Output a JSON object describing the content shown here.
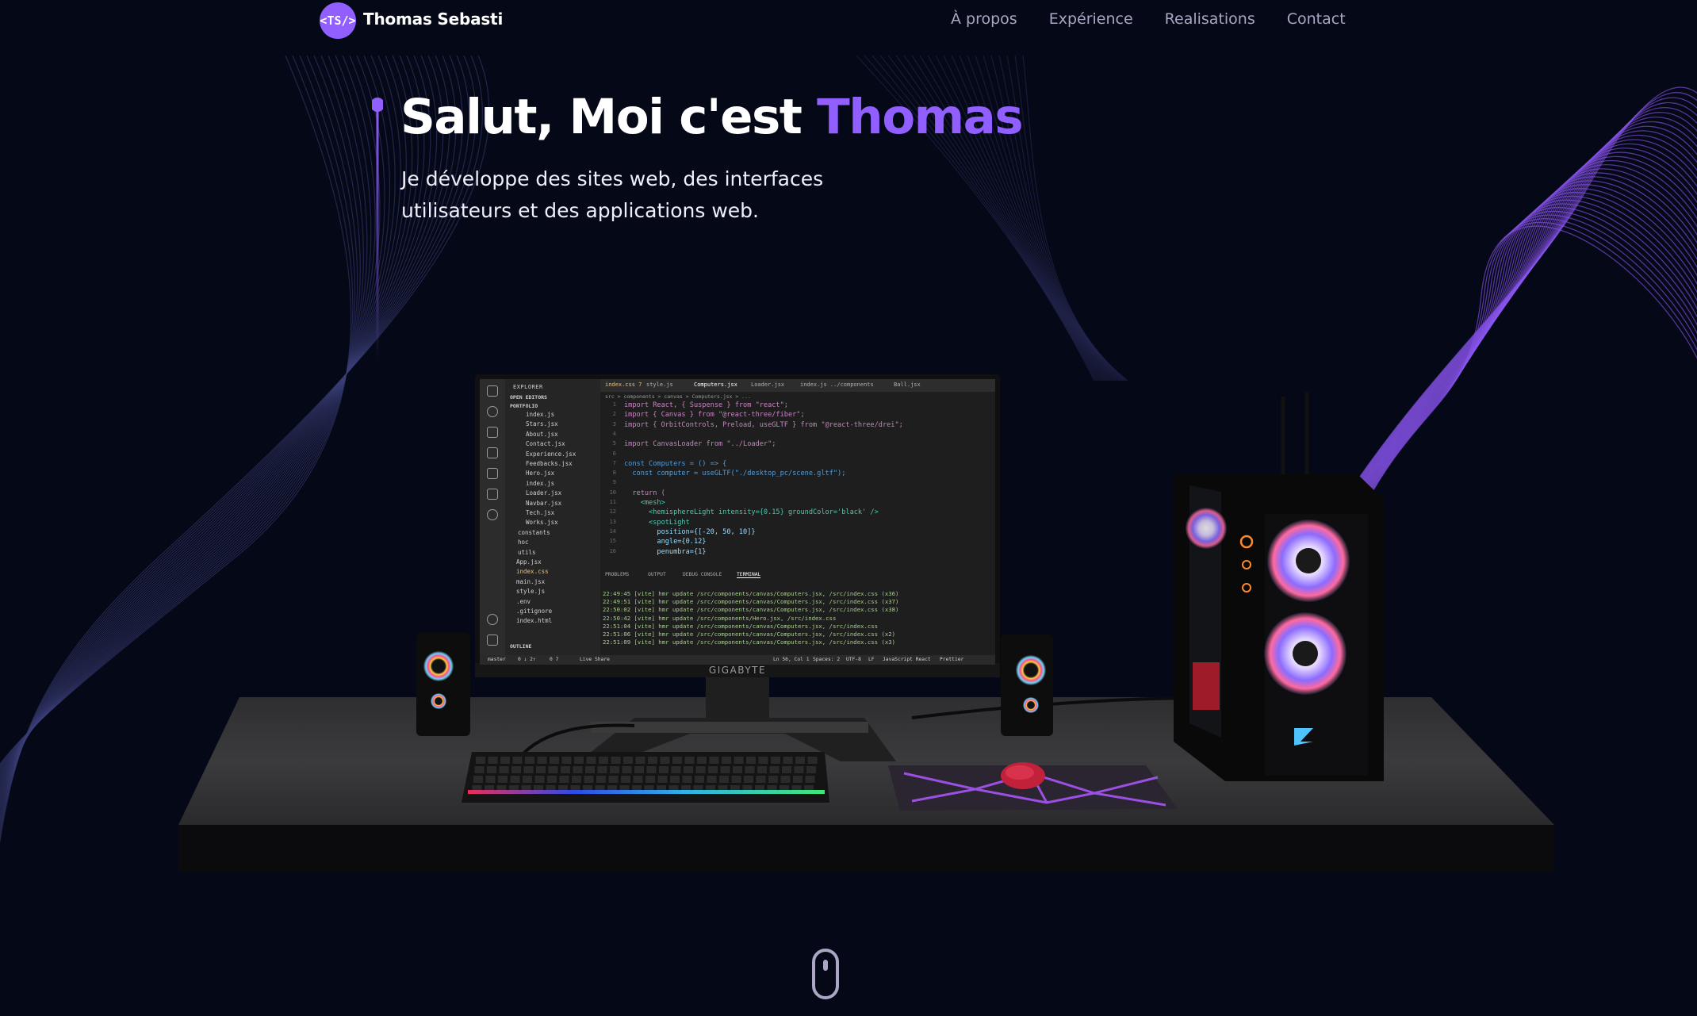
{
  "nav": {
    "logo_text": "<TS/>",
    "brand": "Thomas Sebasti",
    "links": [
      "À propos",
      "Expérience",
      "Realisations",
      "Contact"
    ]
  },
  "hero": {
    "title_prefix": "Salut, Moi c'est ",
    "title_name": "Thomas",
    "subtitle_line1": "Je développe des sites web, des interfaces",
    "subtitle_line2": "utilisateurs et des applications web."
  },
  "monitor": {
    "brand": "GIGABYTE",
    "explorer": {
      "title": "EXPLORER",
      "open_editors": "OPEN EDITORS",
      "project": "PORTFOLIO",
      "files": [
        "index.js",
        "Stars.jsx",
        "About.jsx",
        "Contact.jsx",
        "Experience.jsx",
        "Feedbacks.jsx",
        "Hero.jsx",
        "index.js",
        "Loader.jsx",
        "Navbar.jsx",
        "Tech.jsx",
        "Works.jsx",
        "constants",
        "hoc",
        "utils",
        "App.jsx",
        "index.css",
        "main.jsx",
        "style.js",
        ".env",
        ".gitignore",
        "index.html"
      ],
      "outline": "OUTLINE"
    },
    "tabs": [
      "index.css 7",
      "style.js",
      "Computers.jsx",
      "Loader.jsx",
      "index.js ../components",
      "Ball.jsx"
    ],
    "breadcrumb": "src > components > canvas > Computers.jsx > ...",
    "code_lines": [
      "import React, { Suspense } from \"react\";",
      "import { Canvas } from \"@react-three/fiber\";",
      "import { OrbitControls, Preload, useGLTF } from \"@react-three/drei\";",
      "",
      "import CanvasLoader from \"../Loader\";",
      "",
      "const Computers = () => {",
      "  const computer = useGLTF(\"./desktop_pc/scene.gltf\");",
      "",
      "  return (",
      "    <mesh>",
      "      <hemisphereLight intensity={0.15} groundColor='black' />",
      "      <spotLight",
      "        position={[-20, 50, 10]}",
      "        angle={0.12}",
      "        penumbra={1}"
    ],
    "panel_tabs": [
      "PROBLEMS",
      "OUTPUT",
      "DEBUG CONSOLE",
      "TERMINAL"
    ],
    "terminal_lines": [
      "22:49:45 [vite] hmr update /src/components/canvas/Computers.jsx, /src/index.css (x36)",
      "22:49:51 [vite] hmr update /src/components/canvas/Computers.jsx, /src/index.css (x37)",
      "22:50:02 [vite] hmr update /src/components/canvas/Computers.jsx, /src/index.css (x38)",
      "22:50:42 [vite] hmr update /src/components/Hero.jsx, /src/index.css",
      "22:51:04 [vite] hmr update /src/components/canvas/Computers.jsx, /src/index.css",
      "22:51:06 [vite] hmr update /src/components/canvas/Computers.jsx, /src/index.css (x2)",
      "22:51:09 [vite] hmr update /src/components/canvas/Computers.jsx, /src/index.css (x3)"
    ],
    "status": {
      "branch": "master",
      "sync": "0 ↓ 2↑",
      "problems": "0  7",
      "live_share": "Live Share",
      "position": "Ln 56, Col 1",
      "spaces": "Spaces: 2",
      "encoding": "UTF-8",
      "eol": "LF",
      "language": "JavaScript React",
      "prettier": "Prettier"
    }
  },
  "colors": {
    "background": "#050816",
    "accent": "#915eff",
    "nav_text": "#aaa6c3"
  }
}
